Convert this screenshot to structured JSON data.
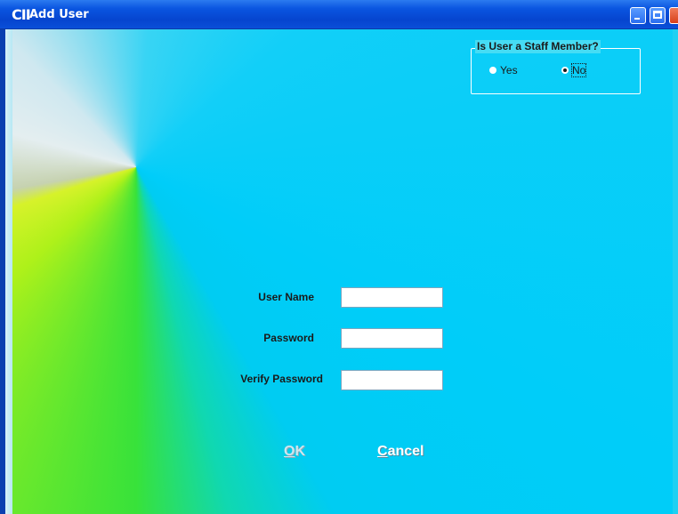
{
  "window": {
    "icon_text": "CII",
    "title": "Add User"
  },
  "staff_group": {
    "legend": "Is User a Staff Member?",
    "options": [
      {
        "label": "Yes",
        "checked": false
      },
      {
        "label": "No",
        "checked": true
      }
    ]
  },
  "form": {
    "username_label": "User Name",
    "username_value": "",
    "password_label": "Password",
    "password_value": "",
    "verify_label": "Verify Password",
    "verify_value": ""
  },
  "buttons": {
    "ok_mnemonic": "O",
    "ok_rest": "K",
    "ok_enabled": false,
    "cancel_mnemonic": "C",
    "cancel_rest": "ancel"
  },
  "colors": {
    "titlebar": "#0645cf",
    "client_primary": "#00cdf9",
    "text": "#1a1a1a"
  }
}
